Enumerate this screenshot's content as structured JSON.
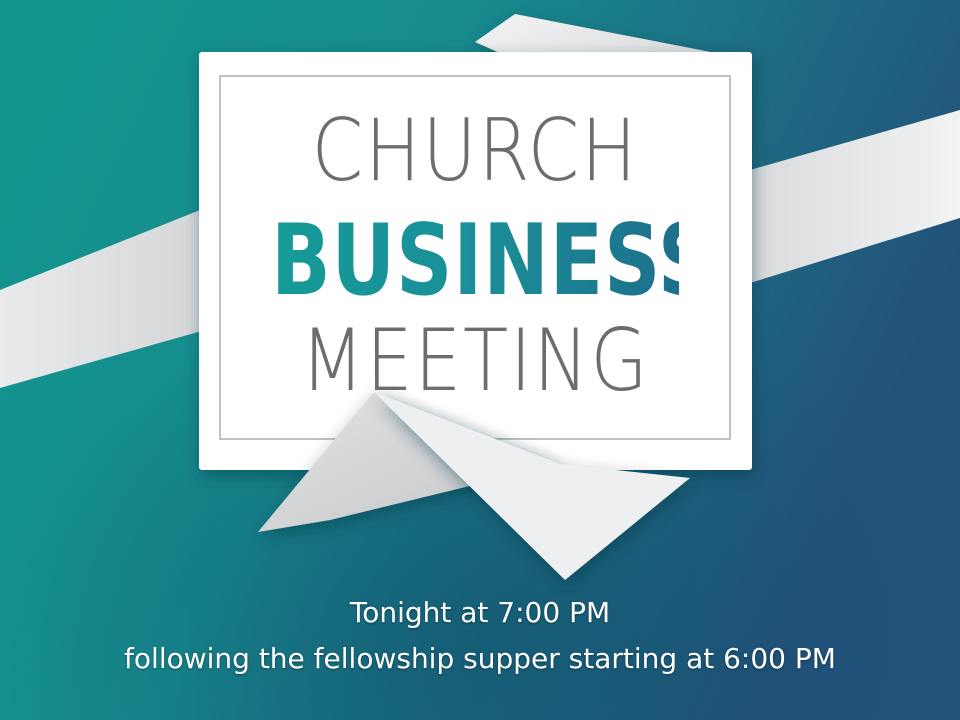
{
  "colors": {
    "background_left": "#15958f",
    "background_right": "#1f4f78",
    "title_gray": "#6b6d70",
    "title_teal": "#159a99",
    "caption_text": "#ffffff"
  },
  "sign": {
    "line_1": "CHURCH",
    "line_2": "BUSINESS",
    "line_3": "MEETING"
  },
  "caption": {
    "line_1": "Tonight at 7:00 PM",
    "line_2": "following the fellowship supper starting at 6:00 PM"
  }
}
